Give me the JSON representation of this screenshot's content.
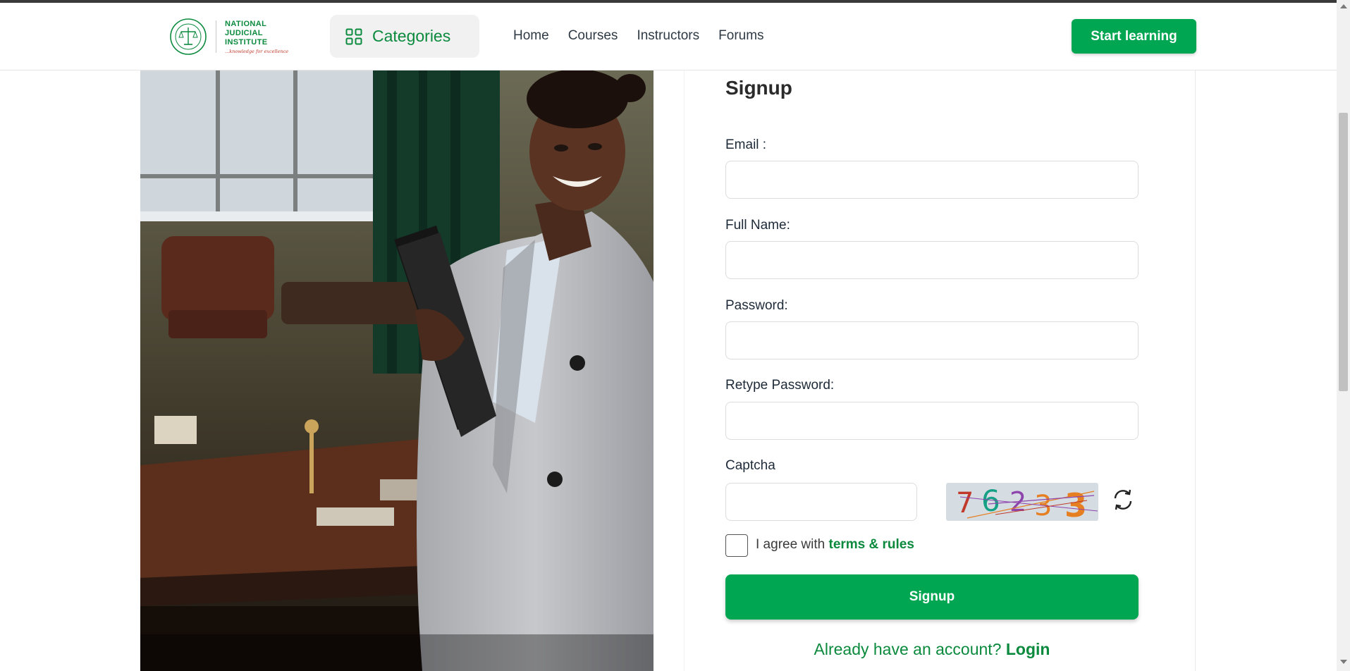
{
  "brand": {
    "lines": [
      "NATIONAL",
      "JUDICIAL",
      "INSTITUTE"
    ],
    "tagline": "...knowledge for excellence",
    "green": "#0b8a3e"
  },
  "header": {
    "categories_label": "Categories",
    "nav": [
      "Home",
      "Courses",
      "Instructors",
      "Forums"
    ],
    "start_label": "Start learning"
  },
  "form": {
    "title": "Signup",
    "email_label": "Email :",
    "fullname_label": "Full Name:",
    "password_label": "Password:",
    "retype_label": "Retype Password:",
    "captcha_label": "Captcha",
    "captcha_code": [
      "7",
      "6",
      "2",
      "3",
      "3"
    ],
    "agree_prefix": "I agree with ",
    "agree_link": "terms & rules",
    "submit_label": "Signup",
    "already_text": "Already have an account? ",
    "login_link": "Login"
  },
  "colors": {
    "accent": "#00a651",
    "text_dark": "#1e2a38"
  }
}
